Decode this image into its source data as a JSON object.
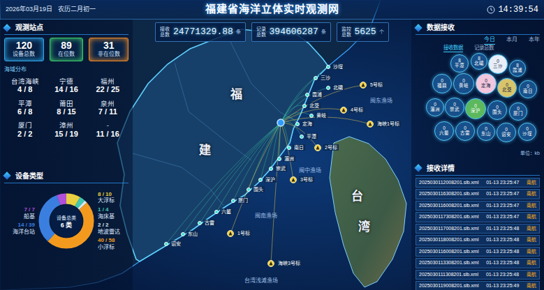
{
  "header": {
    "date": "2026年03月19日",
    "lunar": "农历二月初一",
    "title": "福建省海洋立体实时观测网",
    "time": "14:39:54"
  },
  "stats": [
    {
      "label": "接收总数",
      "value": "24771329.88",
      "unit": "条"
    },
    {
      "label": "记录总数",
      "value": "394606287",
      "unit": "条"
    },
    {
      "label": "监控总数",
      "value": "5625",
      "unit": "个"
    }
  ],
  "stations": {
    "title": "观测站点",
    "summary": [
      {
        "value": "120",
        "label": "设备总数",
        "color": "#2fa8e8"
      },
      {
        "value": "89",
        "label": "在位数",
        "color": "#3ecf6a"
      },
      {
        "value": "31",
        "label": "非在位数",
        "color": "#f08a24"
      }
    ],
    "region_title": "海域分布",
    "regions": [
      {
        "name": "台湾海峡",
        "value": "4 / 8"
      },
      {
        "name": "宁德",
        "value": "14 / 16"
      },
      {
        "name": "福州",
        "value": "22 / 25"
      },
      {
        "name": "平潭",
        "value": "6 / 8"
      },
      {
        "name": "莆田",
        "value": "8 / 15"
      },
      {
        "name": "泉州",
        "value": "7 / 11"
      },
      {
        "name": "厦门",
        "value": "2 / 2"
      },
      {
        "name": "漳州",
        "value": "15 / 19"
      },
      {
        "name": "-",
        "value": "11 / 16"
      }
    ]
  },
  "device_types": {
    "title": "设备类型",
    "center_label": "设备总类",
    "center_count": "6 类",
    "segments": [
      {
        "name": "大浮标",
        "reading": "8 / 10",
        "value": 10,
        "color": "#e8d040"
      },
      {
        "name": "海床基",
        "reading": "1 / 4",
        "value": 4,
        "color": "#40c8b0"
      },
      {
        "name": "地波雷达",
        "reading": "2 / 2",
        "value": 2,
        "color": "#d8e8f0"
      },
      {
        "name": "小浮标",
        "reading": "40 / 58",
        "value": 58,
        "color": "#f39a1e"
      },
      {
        "name": "海洋台站",
        "reading": "14 / 39",
        "value": 39,
        "color": "#3a7fe0"
      },
      {
        "name": "船基",
        "reading": "7 / 7",
        "value": 7,
        "color": "#b24fd8"
      }
    ]
  },
  "reception": {
    "title": "数据接收",
    "tabs": [
      {
        "label": "今日",
        "selected": true
      },
      {
        "label": "本月",
        "selected": false
      },
      {
        "label": "本年",
        "selected": false
      }
    ],
    "subtabs": [
      {
        "label": "接收数据",
        "selected": true
      },
      {
        "label": "记录总数",
        "selected": false
      }
    ],
    "bubbles": [
      {
        "label": "平潭",
        "value": "8",
        "color": "#17508a"
      },
      {
        "label": "北礵",
        "value": "8",
        "color": "#17508a"
      },
      {
        "label": "三沙",
        "value": "0",
        "color": "#e8eef8"
      },
      {
        "label": "霞浦",
        "value": "8",
        "color": "#17508a"
      },
      {
        "label": "福鼎",
        "value": "0",
        "color": "#17508a"
      },
      {
        "label": "黄岐",
        "value": "0",
        "color": "#17508a"
      },
      {
        "label": "定海",
        "value": "0",
        "color": "#f2c6dc"
      },
      {
        "label": "北茭",
        "value": "0",
        "color": "#d9c46a"
      },
      {
        "label": "南日",
        "value": "0",
        "color": "#17508a"
      },
      {
        "label": "湄洲",
        "value": "0",
        "color": "#17508a"
      },
      {
        "label": "崇武",
        "value": "0",
        "color": "#17508a"
      },
      {
        "label": "深沪",
        "value": "0",
        "color": "#5cb85c"
      },
      {
        "label": "围头",
        "value": "0",
        "color": "#17508a"
      },
      {
        "label": "厦门",
        "value": "0",
        "color": "#17508a"
      },
      {
        "label": "六鳌",
        "value": "0",
        "color": "#17508a"
      },
      {
        "label": "古雷",
        "value": "0",
        "color": "#17508a"
      },
      {
        "label": "东山",
        "value": "0",
        "color": "#17508a"
      },
      {
        "label": "诏安",
        "value": "0",
        "color": "#17508a"
      },
      {
        "label": "沙埕",
        "value": "0",
        "color": "#17508a"
      }
    ],
    "unit": "单位：kb"
  },
  "details": {
    "title": "接收详情",
    "rows": [
      {
        "file": "2025030112008201.slb.xml",
        "time": "01-13 23:25:47",
        "tag": "南航"
      },
      {
        "file": "2025030116308201.slb.xml",
        "time": "01-13 23:25:47",
        "tag": "南航"
      },
      {
        "file": "2025030116008201.slb.xml",
        "time": "01-13 23:25:47",
        "tag": "南航"
      },
      {
        "file": "2025030117308201.slb.xml",
        "time": "01-13 23:25:47",
        "tag": "南航"
      },
      {
        "file": "2025030117008201.slb.xml",
        "time": "01-13 23:25:48",
        "tag": "南航"
      },
      {
        "file": "2025030118008201.slb.xml",
        "time": "01-13 23:25:48",
        "tag": "南航"
      },
      {
        "file": "2025030116008201.slb.xml",
        "time": "01-13 23:25:48",
        "tag": "南航"
      },
      {
        "file": "2025030113308201.slb.xml",
        "time": "01-13 23:25:48",
        "tag": "南航"
      },
      {
        "file": "2025030111308201.slb.xml",
        "time": "01-13 23:25:48",
        "tag": "南航"
      },
      {
        "file": "2025030119008201.slb.xml",
        "time": "01-13 23:25:49",
        "tag": "南航"
      }
    ]
  },
  "map": {
    "province_labels": [
      "福",
      "建",
      "台",
      "湾"
    ],
    "fishing_grounds": [
      "闽东渔场",
      "闽中渔场",
      "闽南渔场",
      "台湾浅滩渔场"
    ],
    "buoys": [
      "5号标",
      "4号标",
      "海峡1号标",
      "2号标",
      "3号标",
      "1号标",
      "海峡3号标"
    ],
    "stations": [
      "沙埕",
      "三沙",
      "北礵",
      "霞浦",
      "北茭",
      "黄岐",
      "定海",
      "平潭",
      "南日",
      "湄洲",
      "崇武",
      "深沪",
      "围头",
      "厦门",
      "六鳌",
      "古雷",
      "东山",
      "诏安"
    ]
  }
}
